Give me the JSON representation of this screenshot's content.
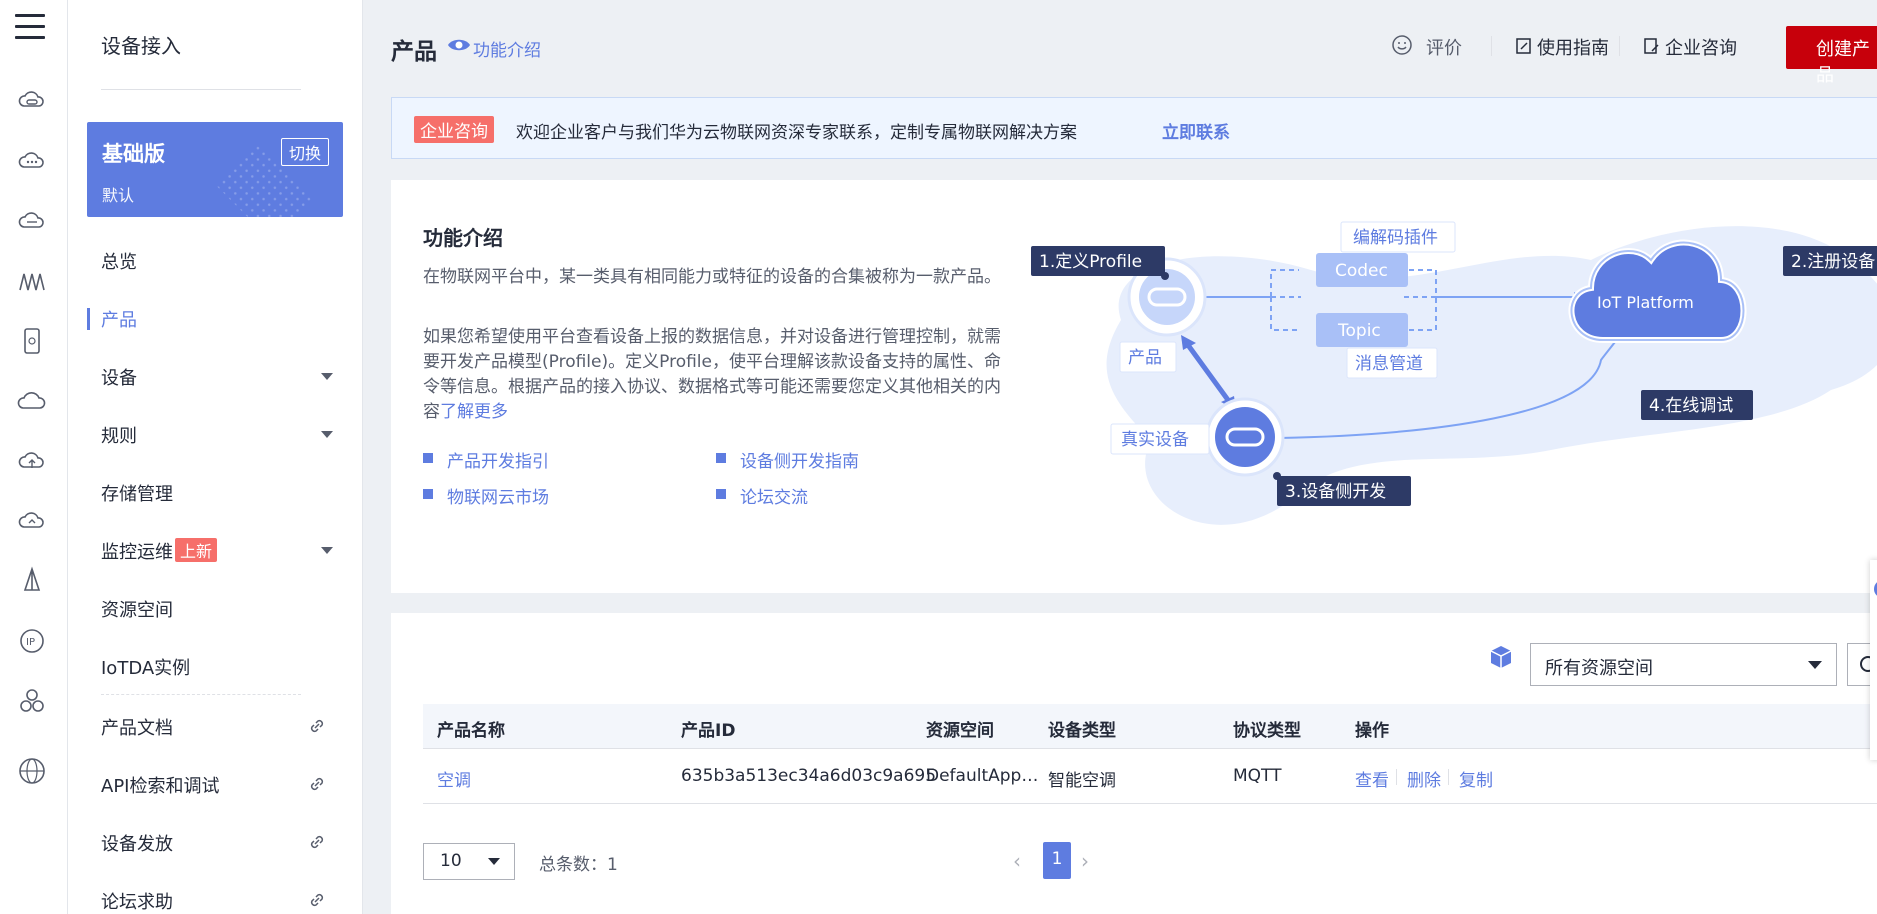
{
  "rail": {
    "icons": [
      "menu-icon",
      "cloud-server-icon",
      "cloud-dots-icon",
      "cloud-link-icon",
      "wave-icon",
      "device-icon",
      "cloud-icon",
      "cloud-upload-icon",
      "cloud-refresh-icon",
      "sail-icon",
      "ip-icon",
      "cluster-icon",
      "globe-icon"
    ]
  },
  "sidebar": {
    "title": "设备接入",
    "edition": {
      "name": "基础版",
      "sub": "默认",
      "switch_label": "切换"
    },
    "items": [
      {
        "label": "总览"
      },
      {
        "label": "产品"
      },
      {
        "label": "设备"
      },
      {
        "label": "规则"
      },
      {
        "label": "存储管理"
      },
      {
        "label": "监控运维",
        "badge": "上新"
      },
      {
        "label": "资源空间"
      },
      {
        "label": "IoTDA实例"
      },
      {
        "label": "产品文档"
      },
      {
        "label": "API检索和调试"
      },
      {
        "label": "设备发放"
      },
      {
        "label": "论坛求助"
      }
    ]
  },
  "header": {
    "title": "产品",
    "intro_link": "功能介绍",
    "actions": [
      {
        "label": "评价"
      },
      {
        "label": "使用指南"
      },
      {
        "label": "企业咨询"
      }
    ],
    "create_label": "创建产品"
  },
  "banner": {
    "tag": "企业咨询",
    "message": "欢迎企业客户与我们华为云物联网资深专家联系，定制专属物联网解决方案",
    "cta": "立即联系"
  },
  "intro": {
    "heading": "功能介绍",
    "para1": "在物联网平台中，某一类具有相同能力或特征的设备的合集被称为一款产品。",
    "para2": "如果您希望使用平台查看设备上报的数据信息，并对设备进行管理控制，就需要开发产品模型(Profile)。定义Profile，使平台理解该款设备支持的属性、命令等信息。根据产品的接入协议、数据格式等可能还需要您定义其他相关的内容",
    "more": "了解更多",
    "links": [
      "产品开发指引",
      "设备侧开发指南",
      "物联网云市场",
      "论坛交流"
    ],
    "diagram": {
      "step1": "1.定义Profile",
      "step2": "2.注册设备",
      "step3": "3.设备侧开发",
      "step4": "4.在线调试",
      "codec_plugin": "编解码插件",
      "codec": "Codec",
      "topic": "Topic",
      "msg_pipe": "消息管道",
      "product": "产品",
      "real_device": "真实设备",
      "platform": "IoT Platform"
    }
  },
  "table": {
    "space_select": "所有资源空间",
    "columns": [
      "产品名称",
      "产品ID",
      "资源空间",
      "设备类型",
      "协议类型",
      "操作"
    ],
    "rows": [
      {
        "name": "空调",
        "id": "635b3a513ec34a6d03c9a695",
        "space": "DefaultApp…",
        "type": "智能空调",
        "protocol": "MQTT",
        "ops": [
          "查看",
          "删除",
          "复制"
        ]
      }
    ],
    "page_size": "10",
    "total_label": "总条数：1",
    "current_page": "1"
  },
  "colors": {
    "accent": "#5e7ce0",
    "danger": "#c7000b",
    "badge": "#f66f6a"
  }
}
